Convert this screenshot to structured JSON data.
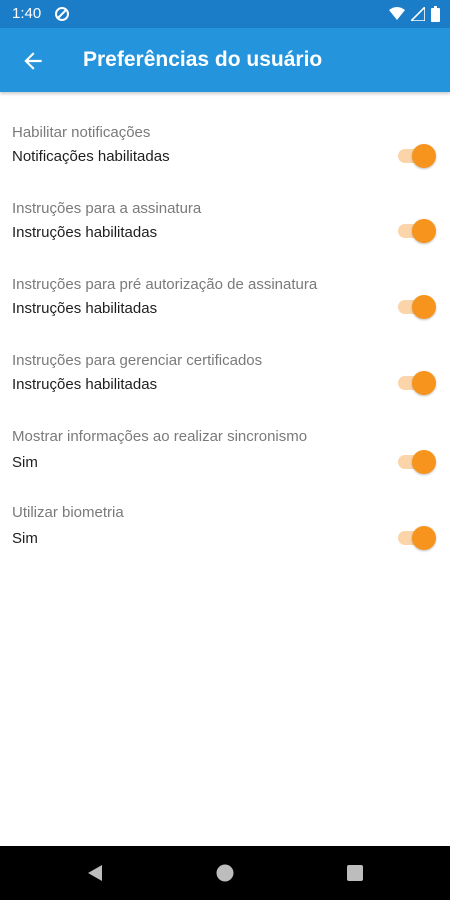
{
  "status_bar": {
    "time": "1:40",
    "icons": [
      "data-saver-icon",
      "wifi-icon",
      "cellular-signal-icon",
      "battery-icon"
    ]
  },
  "app_bar": {
    "title": "Preferências do usuário",
    "back_icon": "arrow-left-icon"
  },
  "colors": {
    "status_bar": "#1b7dc8",
    "app_bar": "#2494dc",
    "switch_thumb": "#f7941d",
    "switch_track": "#fbd5a9"
  },
  "preferences": [
    {
      "title": "Habilitar notificações",
      "summary": "Notificações habilitadas",
      "enabled": true
    },
    {
      "title": "Instruções para a assinatura",
      "summary": "Instruções habilitadas",
      "enabled": true
    },
    {
      "title": "Instruções para pré autorização de assinatura",
      "summary": "Instruções habilitadas",
      "enabled": true
    },
    {
      "title": "Instruções para gerenciar certificados",
      "summary": "Instruções habilitadas",
      "enabled": true
    },
    {
      "title": "Mostrar informações ao realizar sincronismo",
      "summary": "Sim",
      "enabled": true
    },
    {
      "title": "Utilizar biometria",
      "summary": "Sim",
      "enabled": true
    }
  ],
  "nav_bar": {
    "buttons": [
      "back-triangle-icon",
      "home-circle-icon",
      "recents-square-icon"
    ]
  }
}
